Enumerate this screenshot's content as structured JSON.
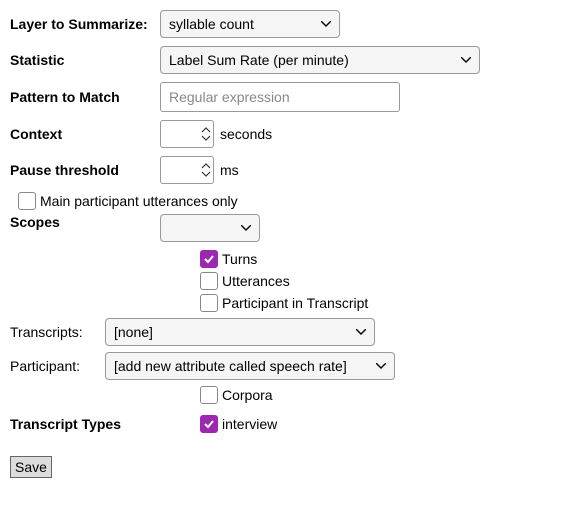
{
  "layer": {
    "label": "Layer to Summarize:",
    "value": "syllable count"
  },
  "statistic": {
    "label": "Statistic",
    "value": "Label Sum Rate (per minute)"
  },
  "pattern": {
    "label": "Pattern to Match",
    "placeholder": "Regular expression",
    "value": ""
  },
  "context": {
    "label": "Context",
    "value": "",
    "unit": "seconds"
  },
  "pause": {
    "label": "Pause threshold",
    "value": "",
    "unit": "ms"
  },
  "mainOnly": {
    "label": "Main participant utterances only",
    "checked": false
  },
  "scopes": {
    "label": "Scopes",
    "select_value": "",
    "items": {
      "turns": {
        "label": "Turns",
        "checked": true
      },
      "utter": {
        "label": "Utterances",
        "checked": false
      },
      "partin": {
        "label": "Participant in Transcript",
        "checked": false
      },
      "transcripts": {
        "label": "Transcripts:",
        "value": "[none]"
      },
      "participant": {
        "label": "Participant:",
        "value": "[add new attribute called speech rate]"
      },
      "corpora": {
        "label": "Corpora",
        "checked": false
      }
    }
  },
  "transcriptTypes": {
    "label": "Transcript Types",
    "items": {
      "interview": {
        "label": "interview",
        "checked": true
      }
    }
  },
  "save_label": "Save"
}
